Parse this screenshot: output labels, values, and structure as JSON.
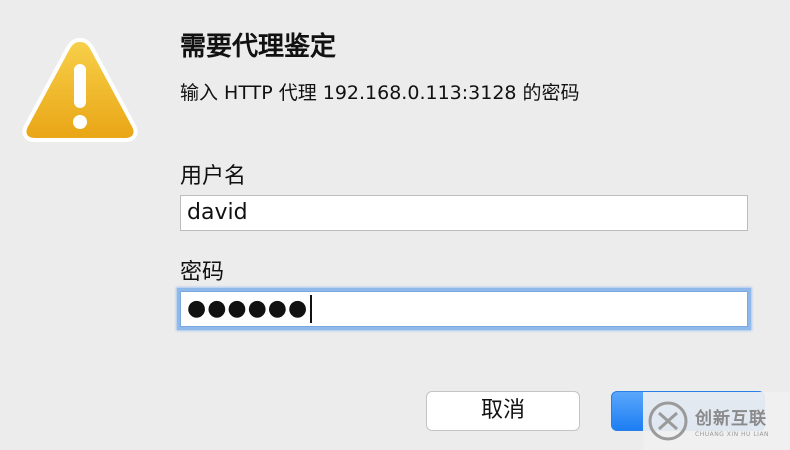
{
  "dialog": {
    "title": "需要代理鉴定",
    "message": "输入 HTTP 代理 192.168.0.113:3128 的密码",
    "username_label": "用户名",
    "username_value": "david",
    "password_label": "密码",
    "password_mask": "●●●●●●",
    "cancel_label": "取消",
    "ok_label": ""
  },
  "watermark": {
    "main": "创新互联",
    "sub": "CHUANG XIN HU LIAN"
  },
  "colors": {
    "background": "#ececec",
    "focus_ring": "#8fb9ea",
    "default_button": "#1d7ef3",
    "warning_icon": "#f2b51e"
  },
  "icons": {
    "warning": "warning-triangle-icon",
    "watermark_logo": "brand-logo-icon"
  }
}
